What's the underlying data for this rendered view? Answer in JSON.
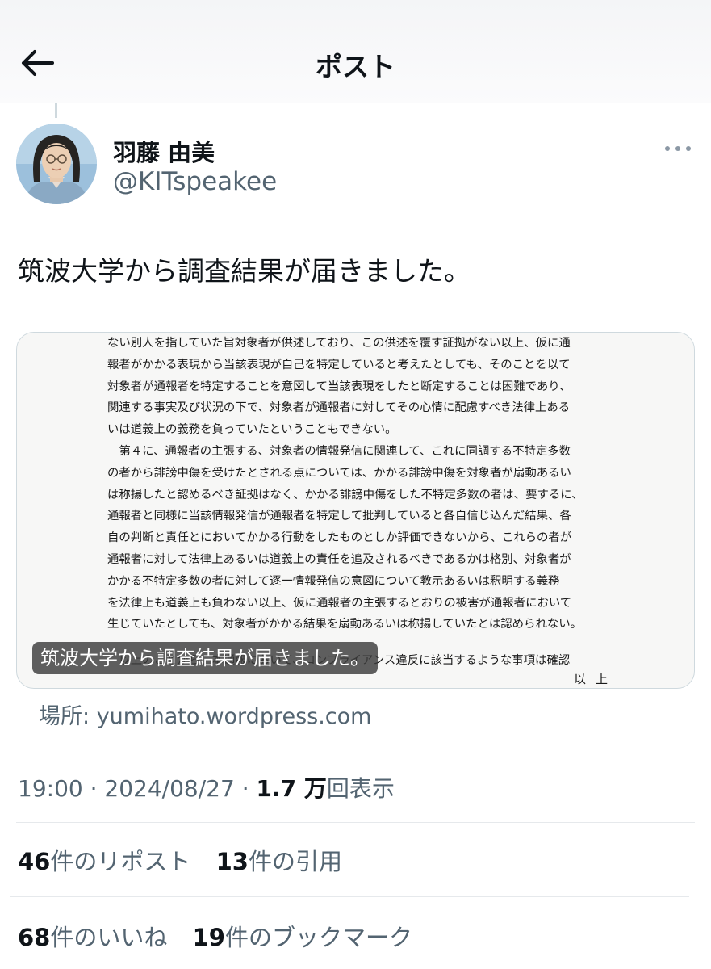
{
  "header": {
    "title": "ポスト"
  },
  "author": {
    "name": "羽藤 由美",
    "handle": "@KITspeakee"
  },
  "tweet": {
    "text": "筑波大学から調査結果が届きました。",
    "media": {
      "alt_badge": "筑波大学から調査結果が届きました。",
      "document_lines": [
        "ない別人を指していた旨対象者が供述しており、この供述を覆す証拠がない以上、仮に通",
        "報者がかかる表現から当該表現が自己を特定していると考えたとしても、そのことを以て",
        "対象者が通報者を特定することを意図して当該表現をしたと断定することは困難であり、",
        "関連する事実及び状況の下で、対象者が通報者に対してその心情に配慮すべき法律上ある",
        "いは道義上の義務を負っていたということもできない。",
        "　第４に、通報者の主張する、対象者の情報発信に関連して、これに同調する不特定多数",
        "の者から誹謗中傷を受けたとされる点については、かかる誹謗中傷を対象者が扇動あるい",
        "は称揚したと認めるべき証拠はなく、かかる誹謗中傷をした不特定多数の者は、要するに、",
        "通報者と同様に当該情報発信が通報者を特定して批判していると各自信じ込んだ結果、各",
        "自の判断と責任とにおいてかかる行動をしたものとしか評価できないから、これらの者が",
        "通報者に対して法律上あるいは道義上の責任を追及されるべきであるかは格別、対象者が",
        "かかる不特定多数の者に対して逐一情報発信の意図について教示あるいは釈明する義務",
        "を法律上も道義上も負わない以上、仮に通報者の主張するとおりの被害が通報者において",
        "生じていたとしても、対象者がかかる結果を扇動あるいは称揚していたとは認められない。"
      ],
      "document_tail_line": "　以上のことから、本通報において、コンプライアンス違反に該当するような事項は確認",
      "document_end": "以上"
    }
  },
  "location": {
    "label": "場所: ",
    "domain": "yumihato.wordpress.com"
  },
  "meta": {
    "time": "19:00",
    "separator": " · ",
    "date": "2024/08/27",
    "views_count": "1.7 万",
    "views_label": "回表示"
  },
  "stats_row1": [
    {
      "count": "46",
      "label": "件のリポスト"
    },
    {
      "count": "13",
      "label": "件の引用"
    }
  ],
  "stats_row2": [
    {
      "count": "68",
      "label": "件のいいね"
    },
    {
      "count": "19",
      "label": "件のブックマーク"
    }
  ],
  "colors": {
    "text": "#0f1419",
    "secondary": "#536471",
    "border": "#cfd9de"
  },
  "icons": {
    "back": "arrow-left-icon",
    "more": "more-horizontal-icon"
  }
}
